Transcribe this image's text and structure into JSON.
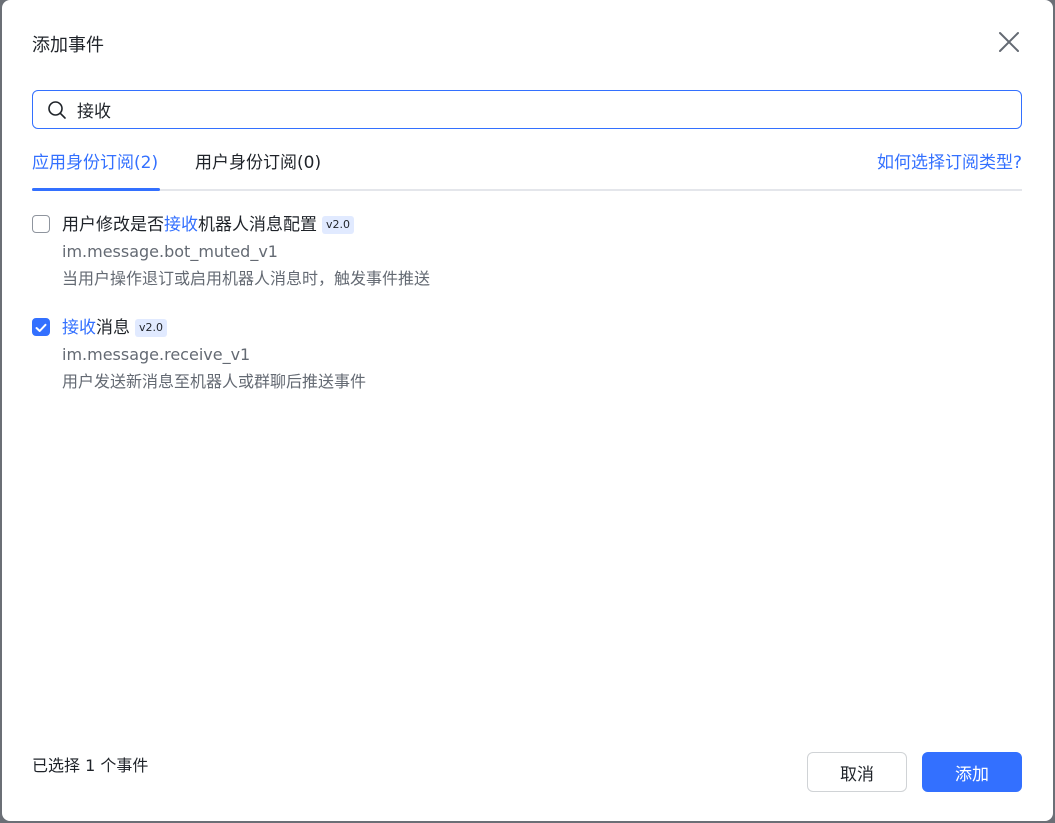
{
  "dialog": {
    "title": "添加事件",
    "close_icon": "close-icon"
  },
  "search": {
    "icon": "search-icon",
    "value": "接收",
    "accent_color": "#3370ff"
  },
  "tabs": [
    {
      "label": "应用身份订阅(2)",
      "active": true
    },
    {
      "label": "用户身份订阅(0)",
      "active": false
    }
  ],
  "help_link": "如何选择订阅类型?",
  "events": [
    {
      "checked": false,
      "title_before": "用户修改是否",
      "title_highlight": "接收",
      "title_after": "机器人消息配置",
      "version": "v2.0",
      "key": "im.message.bot_muted_v1",
      "description": "当用户操作退订或启用机器人消息时，触发事件推送"
    },
    {
      "checked": true,
      "title_before": "",
      "title_highlight": "接收",
      "title_after": "消息",
      "version": "v2.0",
      "key": "im.message.receive_v1",
      "description": "用户发送新消息至机器人或群聊后推送事件"
    }
  ],
  "footer": {
    "selected_count": "已选择 1 个事件",
    "cancel_label": "取消",
    "add_label": "添加"
  }
}
